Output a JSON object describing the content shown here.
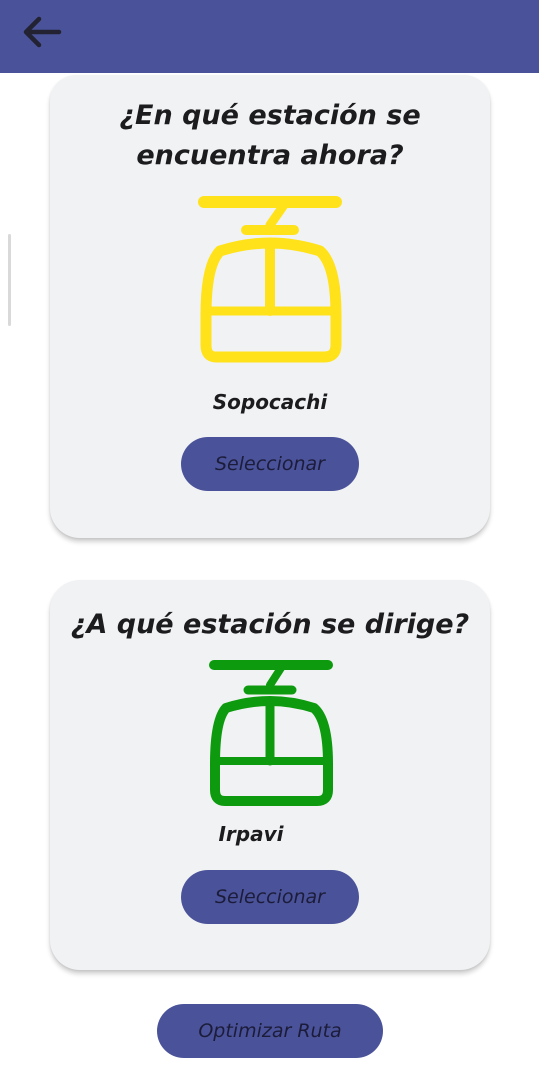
{
  "header": {
    "back_icon": "arrow-left-icon",
    "background": "#4a5399"
  },
  "origin_card": {
    "title": "¿En qué estación se encuentra ahora?",
    "icon": "gondola-icon",
    "icon_color": "#ffe21a",
    "station": "Sopocachi",
    "button_label": "Seleccionar"
  },
  "destination_card": {
    "title": "¿A qué estación se dirige?",
    "icon": "gondola-icon",
    "icon_color": "#0e9a0e",
    "station": "Irpavi",
    "button_label": "Seleccionar"
  },
  "actions": {
    "optimize_label": "Optimizar Ruta"
  },
  "theme": {
    "primary": "#4a5399",
    "card_bg": "#f1f2f4"
  }
}
